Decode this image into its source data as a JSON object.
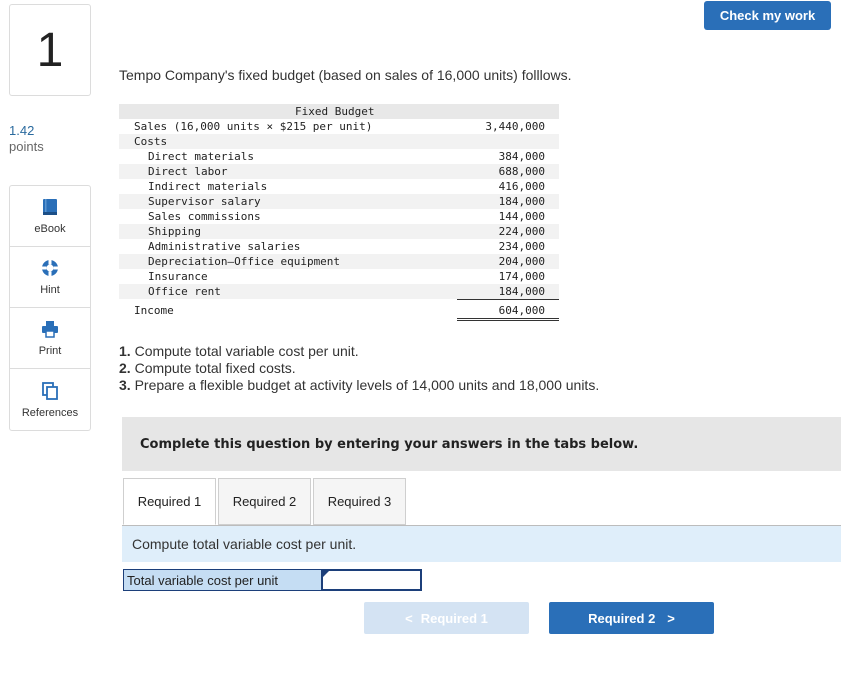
{
  "question": {
    "number": "1",
    "points_value": "1.42",
    "points_label": "points"
  },
  "tools": [
    {
      "label": "eBook",
      "icon": "book-icon"
    },
    {
      "label": "Hint",
      "icon": "lifebuoy-icon"
    },
    {
      "label": "Print",
      "icon": "printer-icon"
    },
    {
      "label": "References",
      "icon": "copy-icon"
    }
  ],
  "check_button": "Check my work",
  "intro": "Tempo Company's fixed budget (based on sales of 16,000 units) folllows.",
  "budget": {
    "header": "Fixed Budget",
    "sales_label": "Sales (16,000 units × $215 per unit)",
    "sales_value": "3,440,000",
    "costs_label": "Costs",
    "costs": [
      {
        "label": "Direct materials",
        "value": "384,000"
      },
      {
        "label": "Direct labor",
        "value": "688,000"
      },
      {
        "label": "Indirect materials",
        "value": "416,000"
      },
      {
        "label": "Supervisor salary",
        "value": "184,000"
      },
      {
        "label": "Sales commissions",
        "value": "144,000"
      },
      {
        "label": "Shipping",
        "value": "224,000"
      },
      {
        "label": "Administrative salaries",
        "value": "234,000"
      },
      {
        "label": "Depreciation—Office equipment",
        "value": "204,000"
      },
      {
        "label": "Insurance",
        "value": "174,000"
      },
      {
        "label": "Office rent",
        "value": "184,000"
      }
    ],
    "income_label": "Income",
    "income_value": "604,000"
  },
  "tasks": [
    {
      "num": "1.",
      "text": " Compute total variable cost per unit."
    },
    {
      "num": "2.",
      "text": " Compute total fixed costs."
    },
    {
      "num": "3.",
      "text": " Prepare a flexible budget at activity levels of 14,000 units and 18,000 units."
    }
  ],
  "instruction": "Complete this question by entering your answers in the tabs below.",
  "tabs": [
    {
      "label": "Required 1",
      "active": true
    },
    {
      "label": "Required 2",
      "active": false
    },
    {
      "label": "Required 3",
      "active": false
    }
  ],
  "question_text": "Compute total variable cost per unit.",
  "answer": {
    "label": "Total variable cost per unit",
    "value": ""
  },
  "nav": {
    "prev_label": "Required 1",
    "next_label": "Required 2",
    "prev_arrow": "<",
    "next_arrow": ">"
  }
}
